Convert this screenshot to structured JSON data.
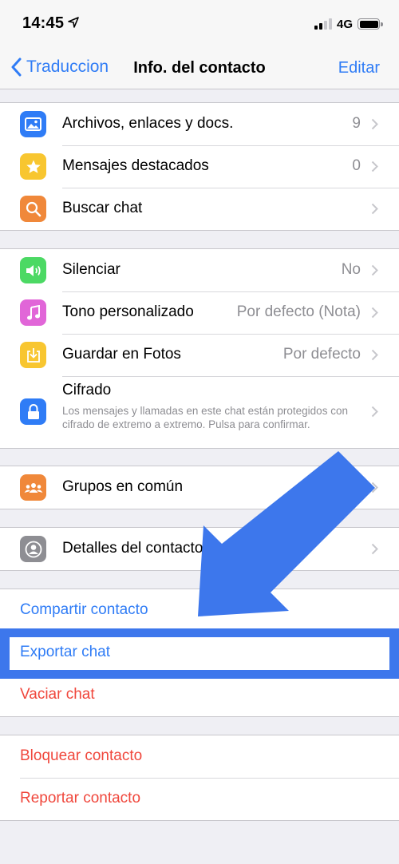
{
  "status_bar": {
    "time": "14:45",
    "network": "4G"
  },
  "nav": {
    "back_label": "Traduccion",
    "title": "Info. del contacto",
    "edit_label": "Editar"
  },
  "section_media": [
    {
      "label": "Archivos, enlaces y docs.",
      "value": "9",
      "icon": "photo-icon",
      "color": "#2f7cf6"
    },
    {
      "label": "Mensajes destacados",
      "value": "0",
      "icon": "star-icon",
      "color": "#f8c630"
    },
    {
      "label": "Buscar chat",
      "value": "",
      "icon": "search-icon",
      "color": "#f0883a"
    }
  ],
  "section_settings": [
    {
      "label": "Silenciar",
      "value": "No",
      "icon": "speaker-icon",
      "color": "#4cd964"
    },
    {
      "label": "Tono personalizado",
      "value": "Por defecto (Nota)",
      "icon": "music-note-icon",
      "color": "#e166d8"
    },
    {
      "label": "Guardar en Fotos",
      "value": "Por defecto",
      "icon": "save-download-icon",
      "color": "#f8c630"
    }
  ],
  "encryption": {
    "title": "Cifrado",
    "description": "Los mensajes y llamadas en este chat están protegidos con cifrado de extremo a extremo. Pulsa para confirmar.",
    "icon": "lock-icon",
    "color": "#2f7cf6"
  },
  "groups": {
    "label": "Grupos en común",
    "icon": "group-icon",
    "color": "#f0883a"
  },
  "contact_details": {
    "label": "Detalles del contacto",
    "icon": "contact-icon",
    "color": "#8e8e93"
  },
  "actions": {
    "share_contact": "Compartir contacto",
    "export_chat": "Exportar chat",
    "clear_chat": "Vaciar chat",
    "block_contact": "Bloquear contacto",
    "report_contact": "Reportar contacto"
  },
  "colors": {
    "accent": "#2f7cf6",
    "destructive": "#f0473c",
    "highlight": "#3d77ec",
    "background": "#efeff4"
  }
}
